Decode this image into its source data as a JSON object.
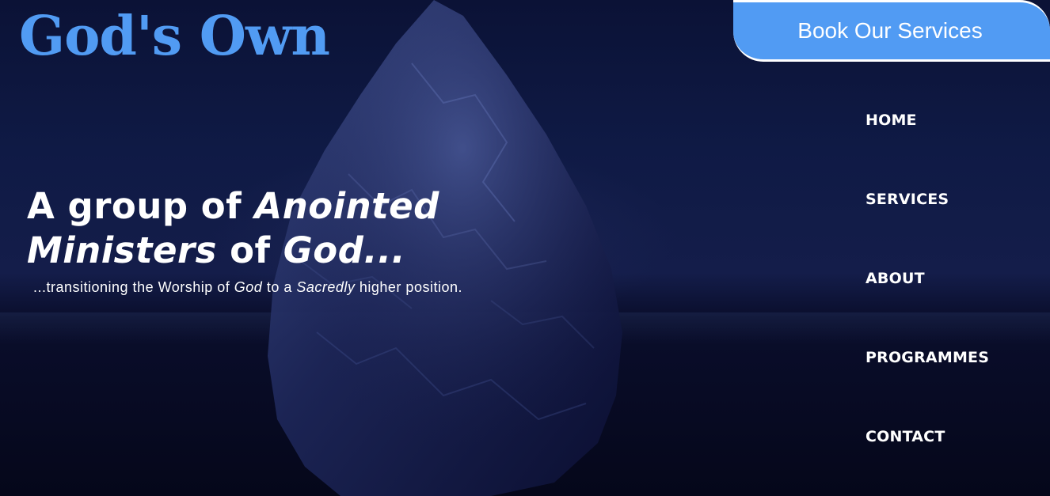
{
  "brand": {
    "logo_text": "God's Own"
  },
  "header": {
    "cta_label": "Book Our Services"
  },
  "nav": {
    "items": [
      {
        "label": "HOME"
      },
      {
        "label": "SERVICES"
      },
      {
        "label": "ABOUT"
      },
      {
        "label": "PROGRAMMES"
      },
      {
        "label": "CONTACT"
      }
    ]
  },
  "hero": {
    "headline_part1": "A group of ",
    "headline_em1": "Anointed Ministers",
    "headline_part2": " of ",
    "headline_em2": "God...",
    "subline_part1": "...transitioning the Worship of ",
    "subline_em1": "God",
    "subline_part2": " to a ",
    "subline_em2": "Sacredly",
    "subline_part3": " higher position."
  },
  "colors": {
    "brand_blue": "#519bf3",
    "background": "#05071c",
    "text": "#ffffff"
  }
}
